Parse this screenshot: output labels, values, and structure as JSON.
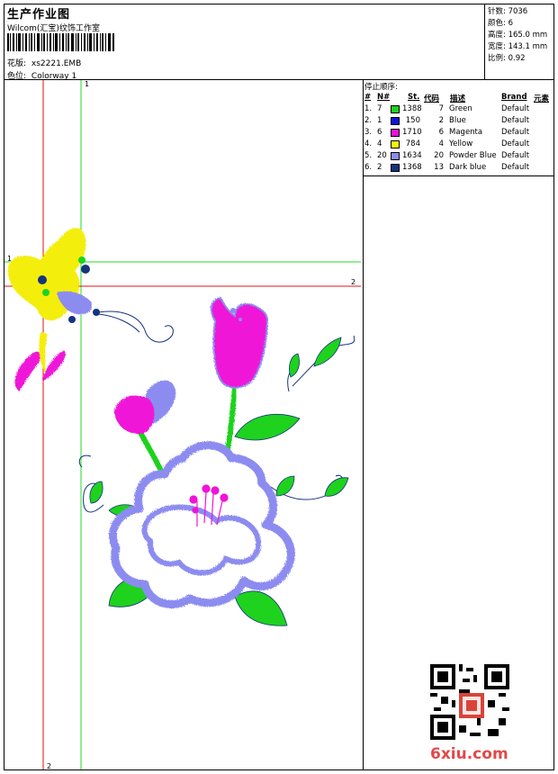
{
  "header": {
    "title": "生产作业图",
    "company": "Wilcom(汇宝)纹饰工作室",
    "design_label": "花版:",
    "design_value": "xs2221.EMB",
    "colorway_label": "色位:",
    "colorway_value": "Colorway 1"
  },
  "stats": [
    {
      "label": "针数:",
      "value": "7036"
    },
    {
      "label": "颜色:",
      "value": "6"
    },
    {
      "label": "高度:",
      "value": "165.0 mm"
    },
    {
      "label": "宽度:",
      "value": "143.1 mm"
    },
    {
      "label": "比例:",
      "value": "0.92"
    }
  ],
  "stop_sequence": {
    "title": "停止顺序:",
    "headers": {
      "num": "#",
      "n": "N#",
      "st": "St.",
      "code": "代码",
      "desc": "描述",
      "brand": "Brand",
      "element": "元素"
    },
    "rows": [
      {
        "num": "1.",
        "n": "7",
        "color": "#1ed21e",
        "st": "1388",
        "code": "7",
        "desc": "Green",
        "brand": "Default"
      },
      {
        "num": "2.",
        "n": "1",
        "color": "#0b17d6",
        "st": "150",
        "code": "2",
        "desc": "Blue",
        "brand": "Default"
      },
      {
        "num": "3.",
        "n": "6",
        "color": "#f012d8",
        "st": "1710",
        "code": "6",
        "desc": "Magenta",
        "brand": "Default"
      },
      {
        "num": "4.",
        "n": "4",
        "color": "#f7f20e",
        "st": "784",
        "code": "4",
        "desc": "Yellow",
        "brand": "Default"
      },
      {
        "num": "5.",
        "n": "20",
        "color": "#8c8cf0",
        "st": "1634",
        "code": "20",
        "desc": "Powder Blue",
        "brand": "Default"
      },
      {
        "num": "6.",
        "n": "2",
        "color": "#15337f",
        "st": "1368",
        "code": "13",
        "desc": "Dark blue",
        "brand": "Default"
      }
    ]
  },
  "guides": {
    "v1": "1",
    "h1": "1",
    "h2": "2",
    "v2": "2"
  },
  "watermark": "6xiu.com",
  "colors": {
    "guide_red": "#e01010",
    "guide_green": "#22dd22"
  }
}
